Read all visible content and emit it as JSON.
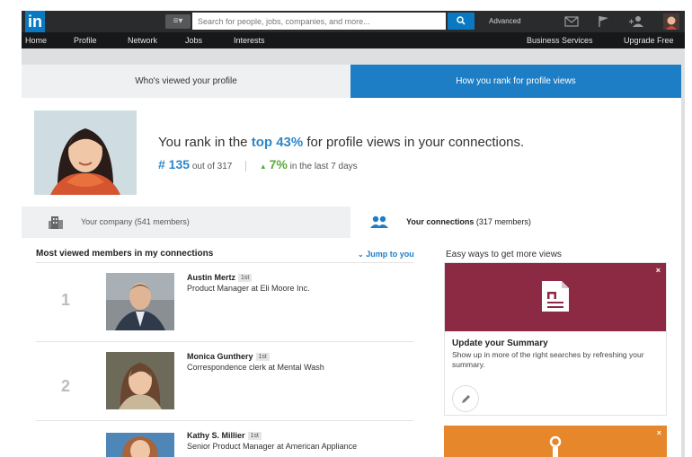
{
  "header": {
    "logo": "in",
    "search_placeholder": "Search for people, jobs, companies, and more...",
    "advanced_label": "Advanced"
  },
  "nav": {
    "items": [
      "Home",
      "Profile",
      "Network",
      "Jobs",
      "Interests"
    ],
    "right_items": [
      "Business Services",
      "Upgrade Free"
    ]
  },
  "tabs": {
    "left": "Who's viewed your profile",
    "right": "How you rank for profile views"
  },
  "rank": {
    "title_prefix": "You rank in the ",
    "title_highlight": "top 43%",
    "title_suffix": " for profile views in your connections.",
    "rank_number": "# 135",
    "out_of": "out of 317",
    "change": "7%",
    "change_label": "in the last 7 days"
  },
  "filters": {
    "company": "Your company (541 members)",
    "connections_bold": "Your connections",
    "connections_rest": "(317 members)"
  },
  "list": {
    "title": "Most viewed members in my connections",
    "jump_label": "Jump to you",
    "members": [
      {
        "rank": "1",
        "name": "Austin Mertz",
        "degree": "1st",
        "title": "Product Manager at Eli Moore Inc."
      },
      {
        "rank": "2",
        "name": "Monica Gunthery",
        "degree": "1st",
        "title": "Correspondence clerk at Mental Wash"
      },
      {
        "rank": "3",
        "name": "Kathy S. Millier",
        "degree": "1st",
        "title": "Senior Product Manager at American Appliance"
      }
    ]
  },
  "tips": {
    "title": "Easy ways to get more views",
    "card_title": "Update your Summary",
    "card_body": "Show up in more of the right searches by refreshing your summary.",
    "close": "×"
  },
  "colors": {
    "brand_blue": "#0b79c2",
    "tab_active": "#1d7ec6",
    "positive_green": "#5aaa3c",
    "banner_maroon": "#8c2a43",
    "banner_orange": "#e5872a"
  }
}
